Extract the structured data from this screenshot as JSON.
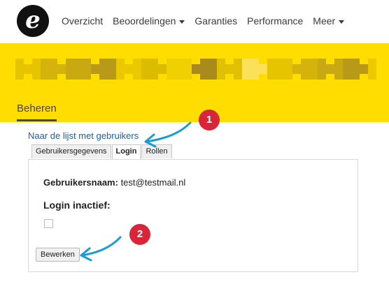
{
  "nav": {
    "items": [
      {
        "label": "Overzicht",
        "has_caret": false
      },
      {
        "label": "Beoordelingen",
        "has_caret": true
      },
      {
        "label": "Garanties",
        "has_caret": false
      },
      {
        "label": "Performance",
        "has_caret": false
      },
      {
        "label": "Meer",
        "has_caret": true
      }
    ]
  },
  "logo": {
    "glyph": "e"
  },
  "header": {
    "tab_label": "Beheren",
    "brand_color": "#ffdd00"
  },
  "content": {
    "back_link": "Naar de lijst met gebruikers",
    "tabs": [
      {
        "label": "Gebruikersgegevens",
        "active": false
      },
      {
        "label": "Login",
        "active": true
      },
      {
        "label": "Rollen",
        "active": false
      }
    ],
    "username_label": "Gebruikersnaam:",
    "username_value": "test@testmail.nl",
    "login_inactive_label": "Login inactief:",
    "edit_button": "Bewerken"
  },
  "annotations": {
    "badge1": "1",
    "badge2": "2",
    "badge_color": "#d9253a",
    "arrow_color": "#1a9ad6"
  }
}
